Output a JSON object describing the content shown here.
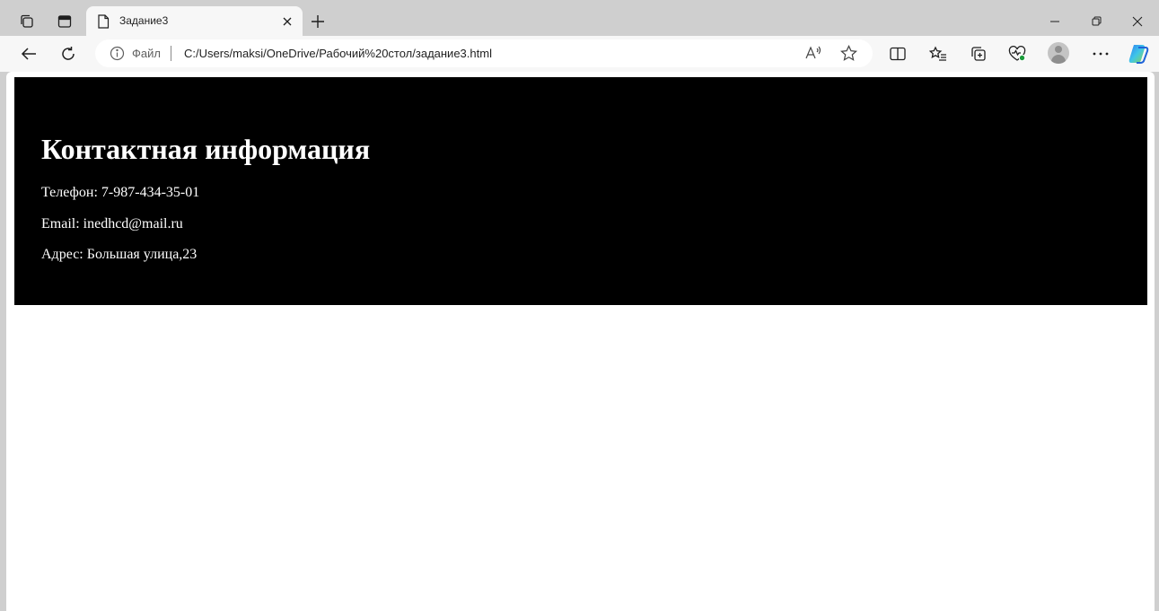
{
  "tab": {
    "title": "Задание3"
  },
  "address_bar": {
    "scheme_label": "Файл",
    "url": "C:/Users/maksi/OneDrive/Рабочий%20стол/задание3.html"
  },
  "contact": {
    "heading": "Контактная информация",
    "phone_label": "Телефон:",
    "phone_value": "7-987-434-35-01",
    "email_label": "Email:",
    "email_value": "inedhcd@mail.ru",
    "address_label": "Адрес:",
    "address_value": "Большая улица,23"
  },
  "icons": {
    "workspaces": "workspaces-icon",
    "tab_actions": "tab-actions-icon",
    "page": "page-icon",
    "close": "close-icon",
    "new_tab": "plus-icon",
    "back": "back-arrow-icon",
    "refresh": "refresh-icon",
    "info": "info-icon",
    "read_aloud": "read-aloud-icon",
    "favorite": "star-icon",
    "split_screen": "split-screen-icon",
    "favorites": "favorites-list-icon",
    "collections": "collections-icon",
    "browser_essentials": "heart-pulse-icon",
    "more": "more-icon",
    "copilot": "copilot-icon"
  },
  "colors": {
    "frame": "#cfcfcf",
    "toolbar": "#f7f7f7",
    "contact_bg": "#000000",
    "contact_text": "#ffffff",
    "essentials_badge": "#1a9b3a"
  }
}
